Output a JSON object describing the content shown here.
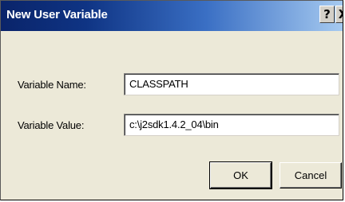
{
  "dialog": {
    "title": "New User Variable",
    "help_button": "?",
    "close_button": "X"
  },
  "form": {
    "name_label": "Variable Name:",
    "name_value": "CLASSPATH",
    "value_label": "Variable Value:",
    "value_value": "c:\\j2sdk1.4.2_04\\bin"
  },
  "buttons": {
    "ok": "OK",
    "cancel": "Cancel"
  },
  "colors": {
    "titlebar_start": "#0a246a",
    "titlebar_end": "#a6caf0",
    "dialog_bg": "#ece9d8"
  }
}
